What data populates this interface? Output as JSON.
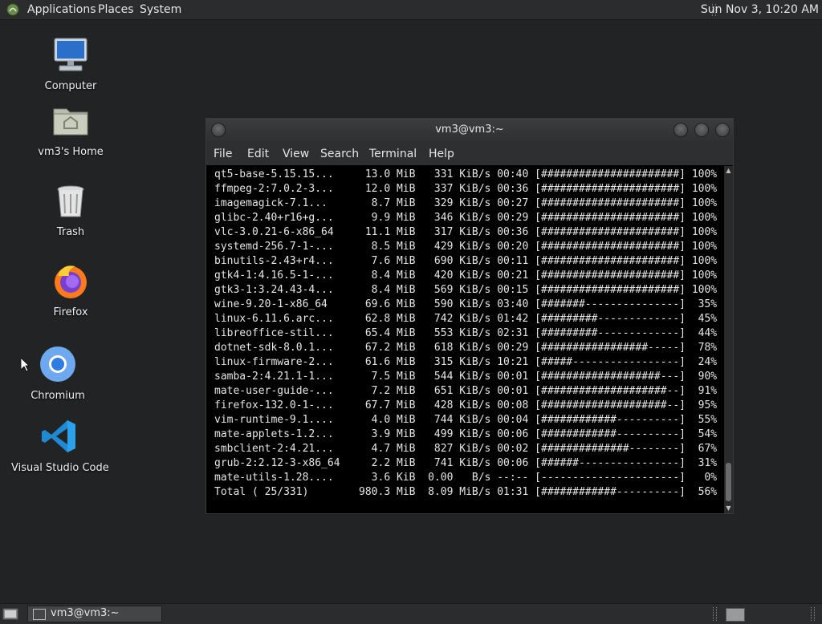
{
  "top_panel": {
    "menus": [
      "Applications",
      "Places",
      "System"
    ],
    "clock": "Sun Nov  3, 10:20 AM"
  },
  "desktop": {
    "icons": [
      {
        "label": "Computer",
        "icon": "computer-icon"
      },
      {
        "label": "vm3's Home",
        "icon": "home-folder-icon"
      },
      {
        "label": "Trash",
        "icon": "trash-icon"
      },
      {
        "label": "Firefox",
        "icon": "firefox-icon"
      },
      {
        "label": "Chromium",
        "icon": "chromium-icon"
      },
      {
        "label": "Visual Studio Code",
        "icon": "vscode-icon"
      }
    ]
  },
  "terminal": {
    "title": "vm3@vm3:~",
    "menu": [
      "File",
      "Edit",
      "View",
      "Search",
      "Terminal",
      "Help"
    ],
    "lines": [
      "qt5-base-5.15.15...     13.0 MiB   331 KiB/s 00:40 [######################] 100%",
      "ffmpeg-2:7.0.2-3...     12.0 MiB   337 KiB/s 00:36 [######################] 100%",
      "imagemagick-7.1...       8.7 MiB   329 KiB/s 00:27 [######################] 100%",
      "glibc-2.40+r16+g...      9.9 MiB   346 KiB/s 00:29 [######################] 100%",
      "vlc-3.0.21-6-x86_64     11.1 MiB   317 KiB/s 00:36 [######################] 100%",
      "systemd-256.7-1-...      8.5 MiB   429 KiB/s 00:20 [######################] 100%",
      "binutils-2.43+r4...      7.6 MiB   690 KiB/s 00:11 [######################] 100%",
      "gtk4-1:4.16.5-1-...      8.4 MiB   420 KiB/s 00:21 [######################] 100%",
      "gtk3-1:3.24.43-4...      8.4 MiB   569 KiB/s 00:15 [######################] 100%",
      "wine-9.20-1-x86_64      69.6 MiB   590 KiB/s 03:40 [#######---------------]  35%",
      "linux-6.11.6.arc...     62.8 MiB   742 KiB/s 01:42 [#########-------------]  45%",
      "libreoffice-stil...     65.4 MiB   553 KiB/s 02:31 [#########-------------]  44%",
      "dotnet-sdk-8.0.1...     67.2 MiB   618 KiB/s 00:29 [#################-----]  78%",
      "linux-firmware-2...     61.6 MiB   315 KiB/s 10:21 [#####-----------------]  24%",
      "samba-2:4.21.1-1...      7.5 MiB   544 KiB/s 00:01 [###################---]  90%",
      "mate-user-guide-...      7.2 MiB   651 KiB/s 00:01 [####################--]  91%",
      "firefox-132.0-1-...     67.7 MiB   428 KiB/s 00:08 [####################--]  95%",
      "vim-runtime-9.1....      4.0 MiB   744 KiB/s 00:04 [############----------]  55%",
      "mate-applets-1.2...      3.9 MiB   499 KiB/s 00:06 [############----------]  54%",
      "smbclient-2:4.21...      4.7 MiB   827 KiB/s 00:02 [##############--------]  67%",
      "grub-2:2.12-3-x86_64     2.2 MiB   741 KiB/s 00:06 [######----------------]  31%",
      "mate-utils-1.28....      3.6 KiB  0.00   B/s --:-- [----------------------]   0%",
      "Total ( 25/331)        980.3 MiB  8.09 MiB/s 01:31 [############----------]  56%"
    ]
  },
  "bottom_panel": {
    "task_label": "vm3@vm3:~"
  }
}
